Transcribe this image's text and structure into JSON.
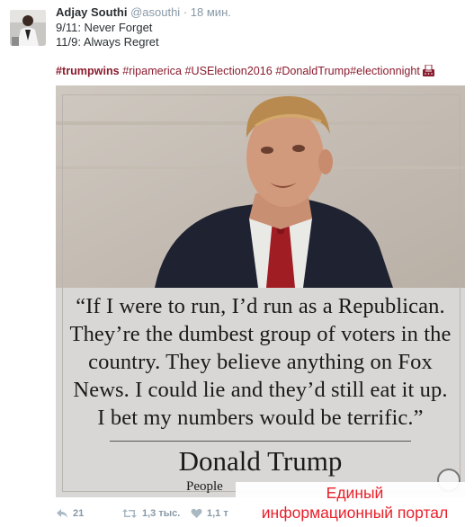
{
  "tweet": {
    "author_name": "Adjay Southi",
    "handle": "@asouthi",
    "separator": "·",
    "time": "18 мин.",
    "lines": [
      "9/11: Never Forget",
      "11/9: Always Regret"
    ],
    "hashtags": [
      "#trumpwins",
      "#ripamerica",
      "#USElection2016",
      "#DonaldTrump",
      "#electionnight"
    ],
    "hashtag_color": "#8a1c2e"
  },
  "image": {
    "quote_lines": [
      "“If I were to run, I’d run as a Republican.",
      "They’re the dumbest group of voters in the",
      "country. They believe anything on Fox",
      "News. I could lie and they’d still eat it up.",
      "I bet my numbers would be terrific.”"
    ],
    "signature": "Donald Trump",
    "source_partial": "People"
  },
  "watermark": {
    "line1": "Единый",
    "line2": "информационный портал",
    "color": "#e8202a"
  },
  "actions": {
    "reply_icon": "reply-icon",
    "reply_count": "21",
    "retweet_icon": "retweet-icon",
    "retweet_count": "1,3 тыс.",
    "like_icon": "heart-icon",
    "like_count": "1,1 т"
  }
}
